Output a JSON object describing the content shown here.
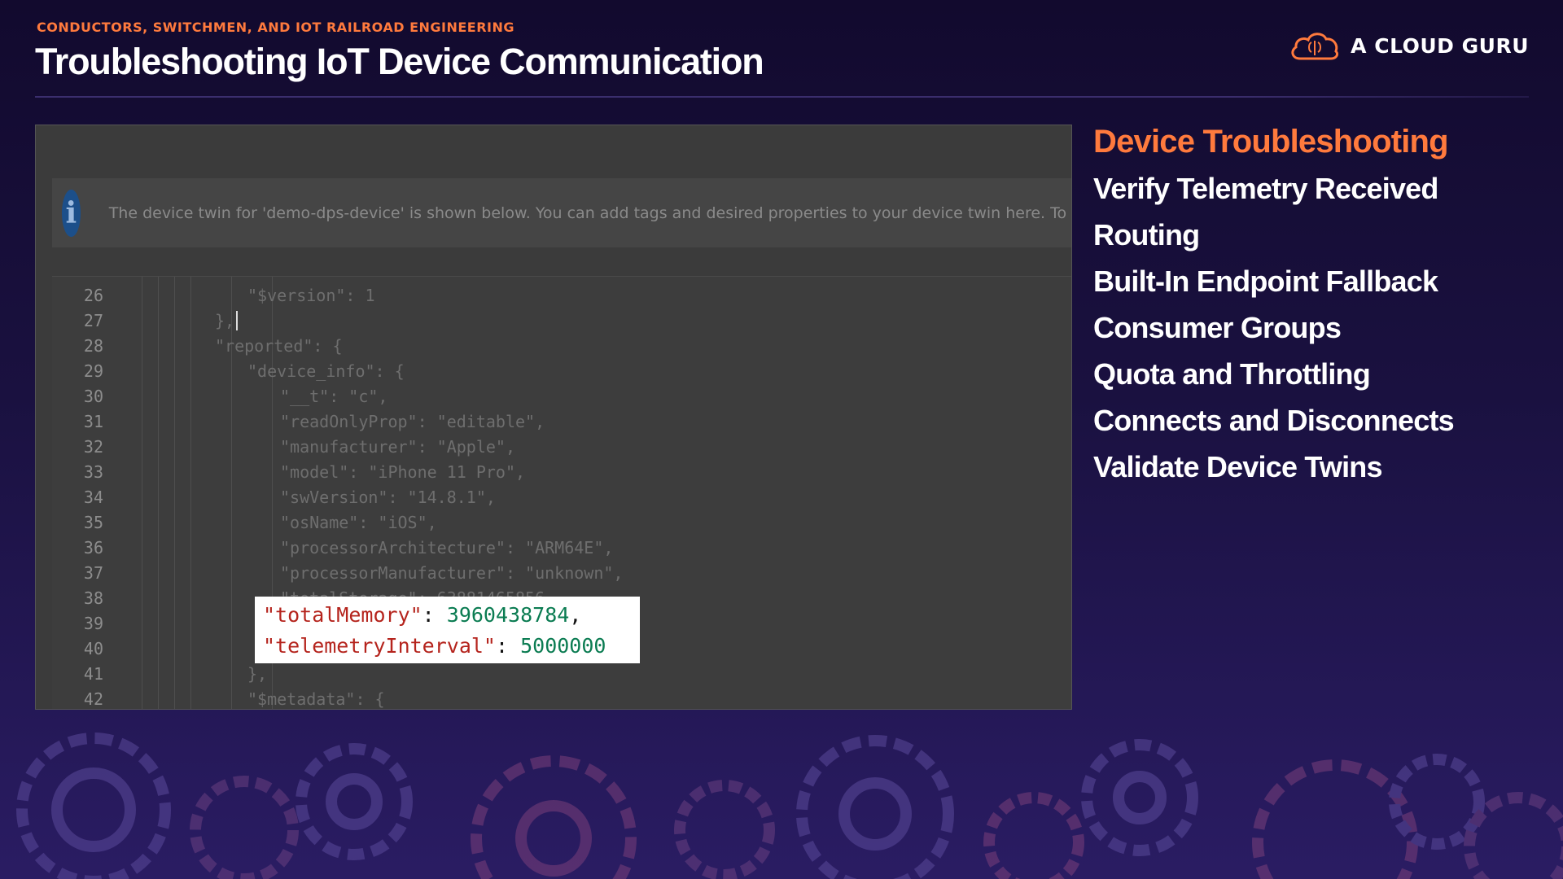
{
  "header": {
    "kicker": "CONDUCTORS, SWITCHMEN, AND IOT RAILROAD ENGINEERING",
    "title": "Troubleshooting IoT Device Communication",
    "brand": "A CLOUD GURU"
  },
  "info_banner": {
    "text": "The device twin for 'demo-dps-device' is shown below. You can add tags and desired properties to your device twin here. To r"
  },
  "code_lines": [
    {
      "no": "26",
      "text": "\"$version\": 1"
    },
    {
      "no": "27",
      "text": "},"
    },
    {
      "no": "28",
      "text": "\"reported\": {"
    },
    {
      "no": "29",
      "text": "\"device_info\": {"
    },
    {
      "no": "30",
      "text": "\"__t\": \"c\","
    },
    {
      "no": "31",
      "text": "\"readOnlyProp\": \"editable\","
    },
    {
      "no": "32",
      "text": "\"manufacturer\": \"Apple\","
    },
    {
      "no": "33",
      "text": "\"model\": \"iPhone 11 Pro\","
    },
    {
      "no": "34",
      "text": "\"swVersion\": \"14.8.1\","
    },
    {
      "no": "35",
      "text": "\"osName\": \"iOS\","
    },
    {
      "no": "36",
      "text": "\"processorArchitecture\": \"ARM64E\","
    },
    {
      "no": "37",
      "text": "\"processorManufacturer\": \"unknown\","
    },
    {
      "no": "38",
      "text": "\"totalStorage\": 63881465856,"
    },
    {
      "no": "39",
      "text": ""
    },
    {
      "no": "40",
      "text": ""
    },
    {
      "no": "41",
      "text": "},"
    },
    {
      "no": "42",
      "text": "\"$metadata\": {"
    }
  ],
  "callout": {
    "line1_key": "\"totalMemory\"",
    "line1_sep": ": ",
    "line1_val": "3960438784",
    "line1_end": ",",
    "line2_key": "\"telemetryInterval\"",
    "line2_sep": ": ",
    "line2_val": "5000000"
  },
  "outline": {
    "items": [
      "Device Troubleshooting",
      "Verify Telemetry Received",
      "Routing",
      "Built-In Endpoint Fallback",
      "Consumer Groups",
      "Quota and Throttling",
      "Connects and Disconnects",
      "Validate Device Twins"
    ],
    "active_index": 0
  },
  "colors": {
    "accent": "#ff7a3d",
    "background": "#1a1140"
  }
}
